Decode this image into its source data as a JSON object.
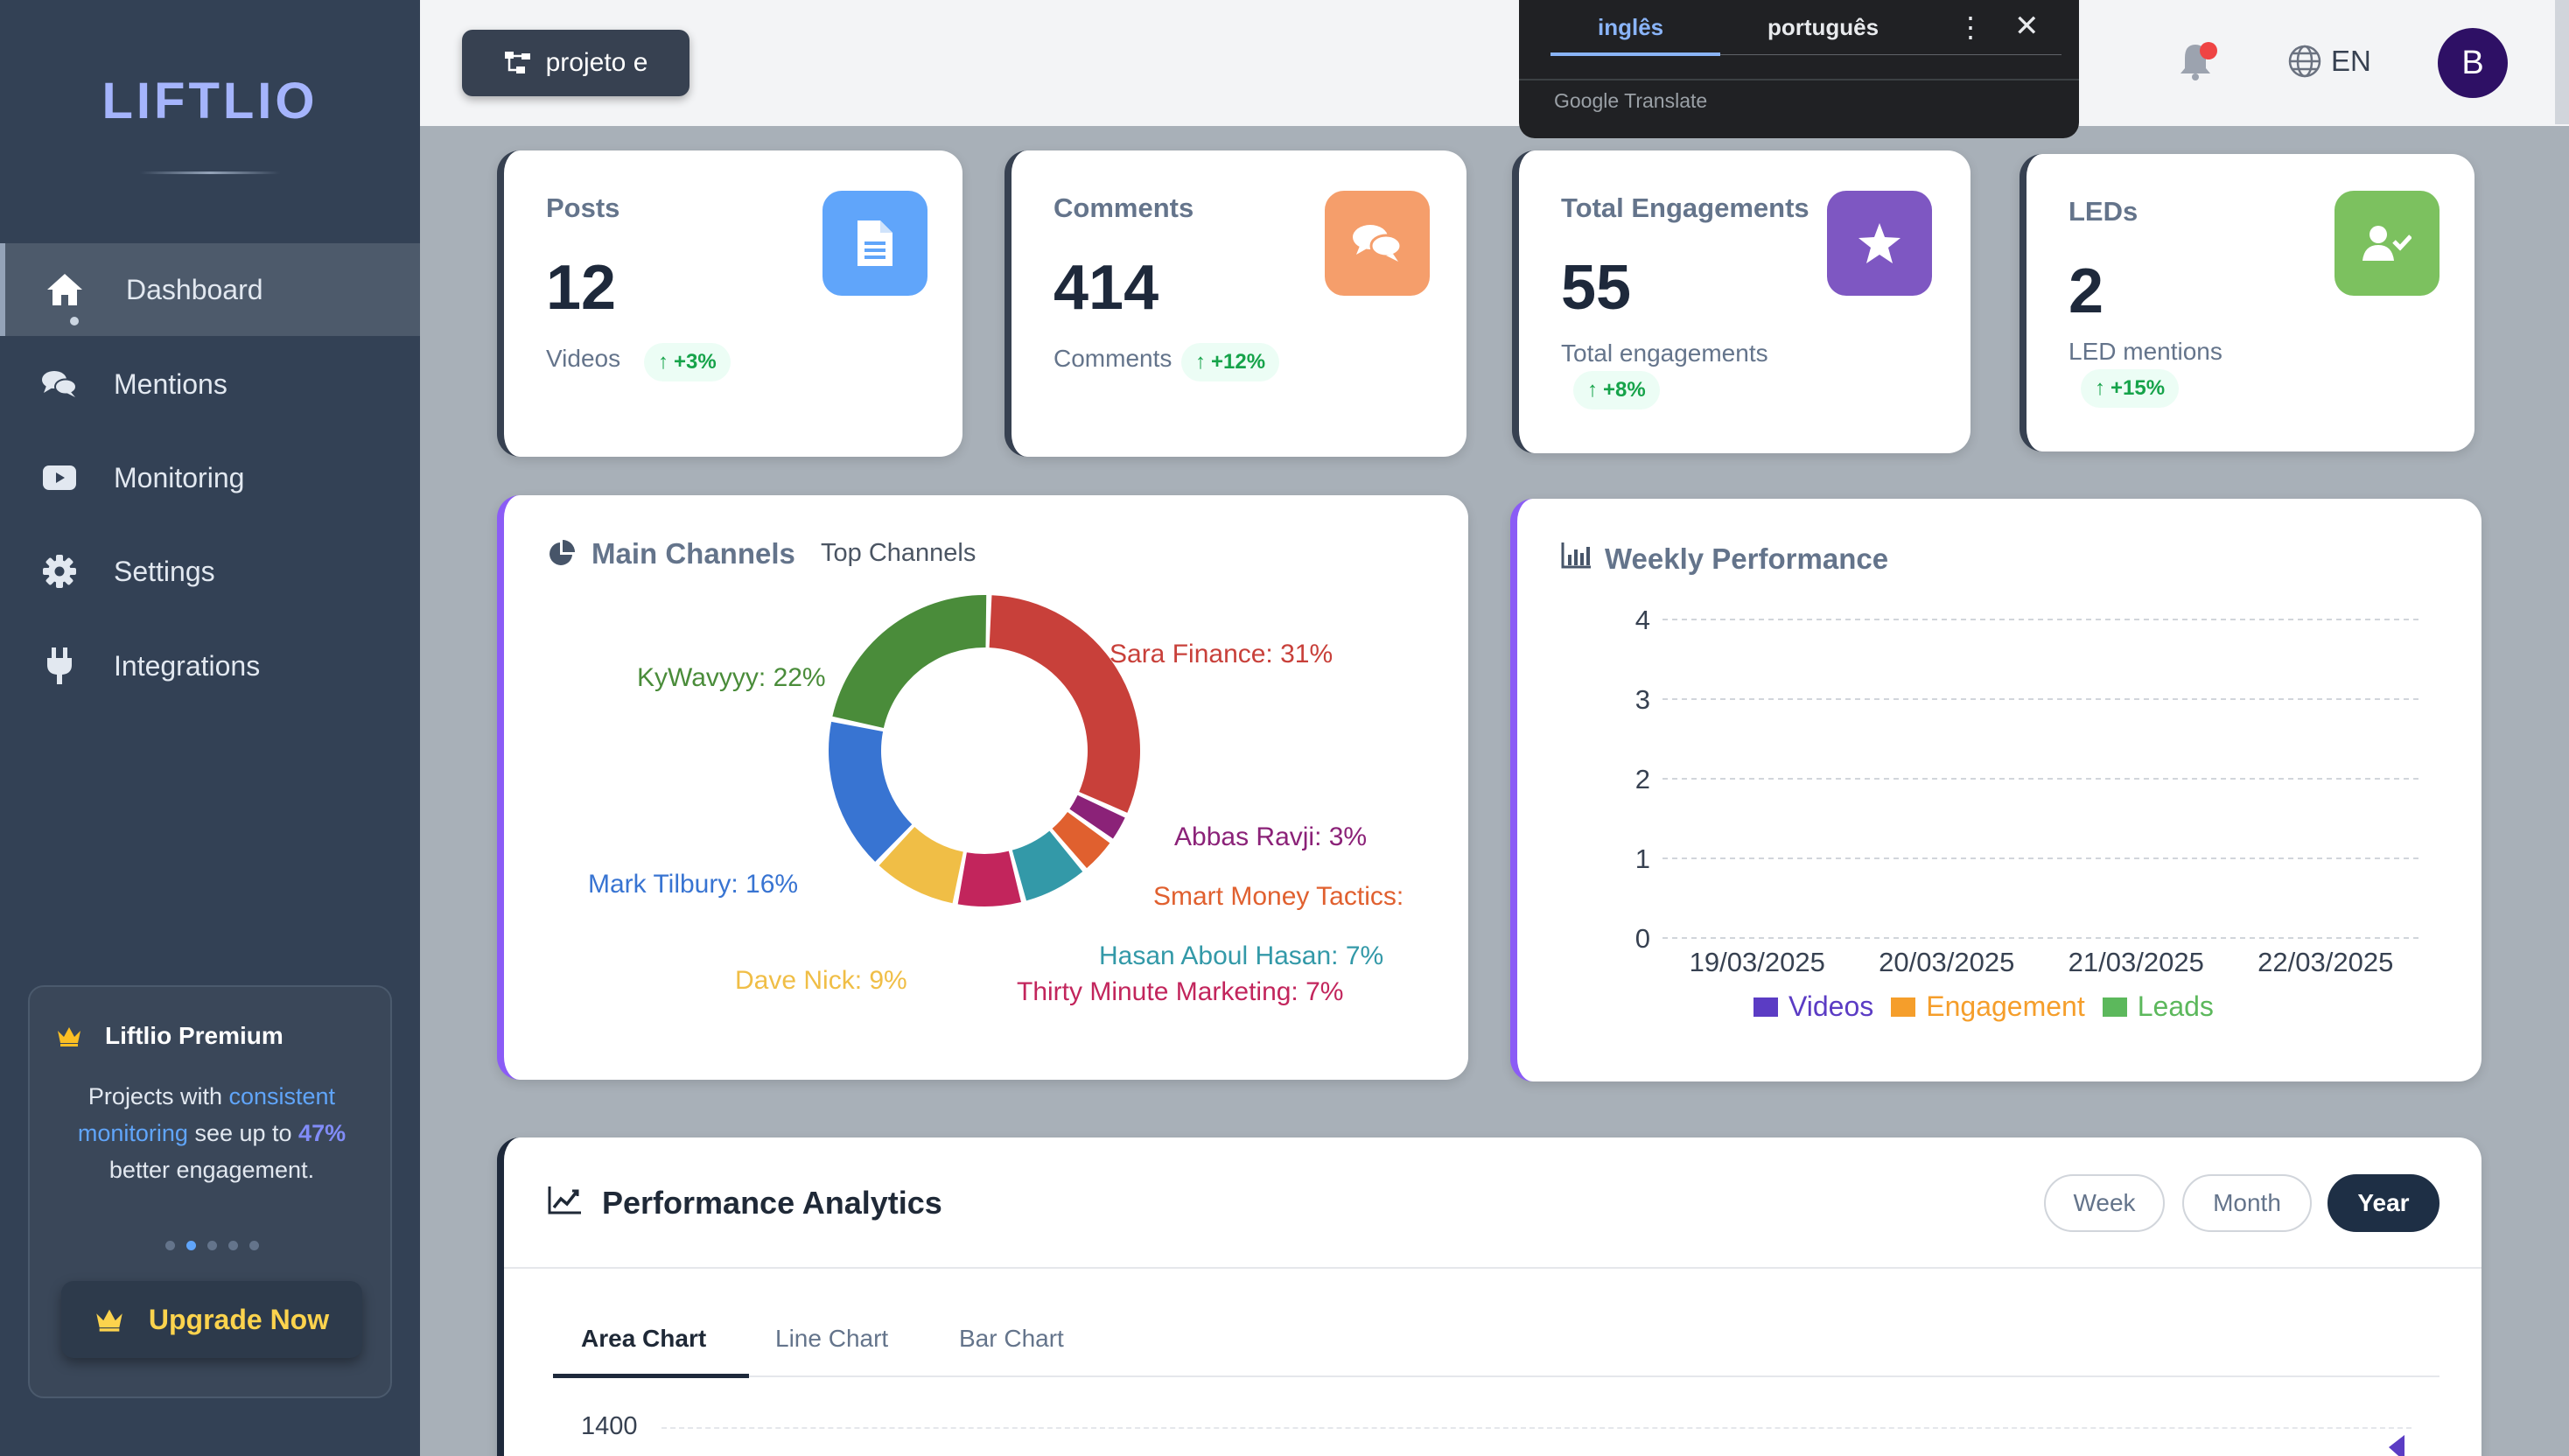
{
  "app": {
    "logo": "LIFTLIO"
  },
  "sidebar": {
    "items": [
      {
        "label": "Dashboard",
        "icon": "home-icon",
        "active": true
      },
      {
        "label": "Mentions",
        "icon": "comments-icon"
      },
      {
        "label": "Monitoring",
        "icon": "youtube-icon"
      },
      {
        "label": "Settings",
        "icon": "gear-icon"
      },
      {
        "label": "Integrations",
        "icon": "plug-icon"
      }
    ],
    "premium": {
      "title": "Liftlio Premium",
      "text_a": "Projects with ",
      "text_hl": "consistent monitoring",
      "text_b": " see up to ",
      "text_pct": "47%",
      "text_c": " better engagement.",
      "upgrade_label": "Upgrade Now"
    }
  },
  "topbar": {
    "project_label": "projeto e",
    "language": "EN",
    "avatar_initial": "B",
    "translate_popup": {
      "tab_source": "inglês",
      "tab_target": "português",
      "brand": "Google Translate"
    }
  },
  "stats": [
    {
      "title": "Posts",
      "value": "12",
      "sub": "Videos",
      "change": "+3%",
      "icon": "document-icon",
      "color": "#60a5fa"
    },
    {
      "title": "Comments",
      "value": "414",
      "sub": "Comments",
      "change": "+12%",
      "icon": "chat-bubbles-icon",
      "color": "#f59e6b"
    },
    {
      "title": "Total Engagements",
      "value": "55",
      "sub": "Total engagements",
      "change": "+8%",
      "icon": "star-icon",
      "color": "#7e57c2"
    },
    {
      "title": "LEDs",
      "value": "2",
      "sub": "LED mentions",
      "change": "+15%",
      "icon": "user-check-icon",
      "color": "#7cc15f"
    }
  ],
  "channels": {
    "title": "Main Channels",
    "subtitle": "Top Channels",
    "chart_data": {
      "type": "pie",
      "series": [
        {
          "name": "Sara Finance",
          "value": 31,
          "label": "Sara Finance: 31%",
          "color": "#c8403a"
        },
        {
          "name": "Abbas Ravji",
          "value": 3,
          "label": "Abbas Ravji: 3%",
          "color": "#8b2278"
        },
        {
          "name": "Smart Money Tactics",
          "value": 4,
          "label": "Smart Money Tactics:",
          "color": "#e0602f"
        },
        {
          "name": "Hasan Aboul Hasan",
          "value": 7,
          "label": "Hasan Aboul Hasan: 7%",
          "color": "#3399a8"
        },
        {
          "name": "Thirty Minute Marketing",
          "value": 7,
          "label": "Thirty Minute Marketing: 7%",
          "color": "#c2255c"
        },
        {
          "name": "Dave Nick",
          "value": 9,
          "label": "Dave Nick: 9%",
          "color": "#f0be46"
        },
        {
          "name": "Mark Tilbury",
          "value": 16,
          "label": "Mark Tilbury: 16%",
          "color": "#3874d2"
        },
        {
          "name": "KyWavyyy",
          "value": 22,
          "label": "KyWavyyy: 22%",
          "color": "#4a8c3a"
        }
      ]
    }
  },
  "weekly": {
    "title": "Weekly Performance",
    "chart_data": {
      "type": "bar",
      "categories": [
        "19/03/2025",
        "20/03/2025",
        "21/03/2025",
        "22/03/2025"
      ],
      "ylim": [
        0,
        4
      ],
      "yticks": [
        "4",
        "3",
        "2",
        "1",
        "0"
      ],
      "series": [
        {
          "name": "Videos",
          "values": [
            0,
            0,
            0,
            0
          ],
          "color": "#5b3cc4"
        },
        {
          "name": "Engagement",
          "values": [
            0,
            0,
            0,
            0
          ],
          "color": "#f59e2b"
        },
        {
          "name": "Leads",
          "values": [
            0,
            0,
            0,
            0
          ],
          "color": "#5cb85c"
        }
      ]
    }
  },
  "analytics": {
    "title": "Performance Analytics",
    "ranges": [
      "Week",
      "Month",
      "Year"
    ],
    "active_range": "Year",
    "tabs": [
      "Area Chart",
      "Line Chart",
      "Bar Chart"
    ],
    "active_tab": "Area Chart",
    "y_top_label": "1400"
  }
}
